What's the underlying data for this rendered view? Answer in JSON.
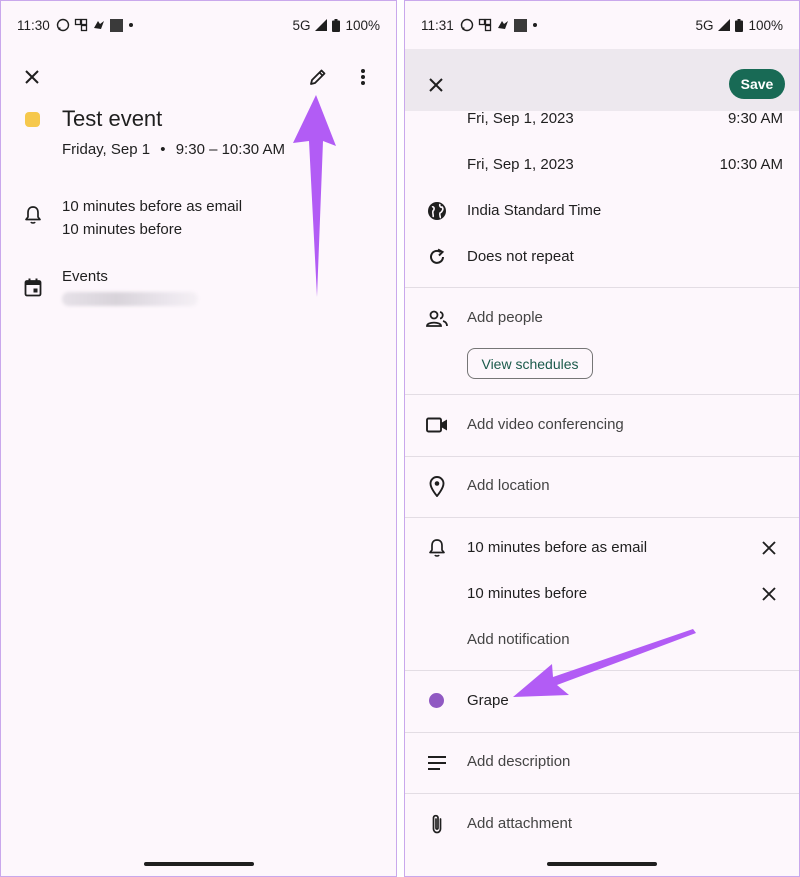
{
  "left": {
    "status": {
      "time": "11:30",
      "network": "5G",
      "battery": "100%"
    },
    "event": {
      "title": "Test event",
      "date": "Friday, Sep 1",
      "separator": "•",
      "time_range": "9:30 – 10:30 AM",
      "color": "#f6c84c"
    },
    "notifications": [
      "10 minutes before as email",
      "10 minutes before"
    ],
    "calendar_label": "Events"
  },
  "right": {
    "status": {
      "time": "11:31",
      "network": "5G",
      "battery": "100%"
    },
    "save_label": "Save",
    "start": {
      "date": "Fri, Sep 1, 2023",
      "time": "9:30 AM"
    },
    "end": {
      "date": "Fri, Sep 1, 2023",
      "time": "10:30 AM"
    },
    "timezone": "India Standard Time",
    "repeat": "Does not repeat",
    "add_people": "Add people",
    "view_schedules": "View schedules",
    "video": "Add video conferencing",
    "location": "Add location",
    "notifications": [
      "10 minutes before as email",
      "10 minutes before"
    ],
    "add_notification": "Add notification",
    "color": {
      "name": "Grape",
      "hex": "#9059c2"
    },
    "description": "Add description",
    "attachment": "Add attachment"
  },
  "colors": {
    "accent_save": "#186a55",
    "annotation_arrow": "#b25cf5"
  }
}
